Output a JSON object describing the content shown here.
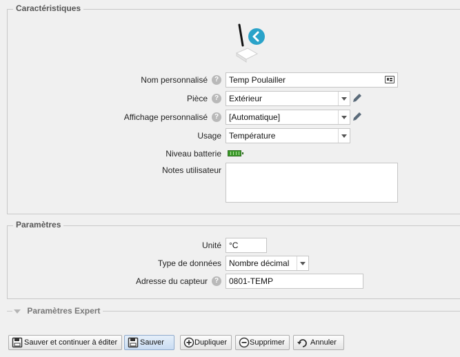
{
  "characteristics": {
    "legend": "Caractéristiques",
    "name": {
      "label": "Nom personnalisé",
      "value": "Temp Poulailler"
    },
    "room": {
      "label": "Pièce",
      "value": "Extérieur"
    },
    "display": {
      "label": "Affichage personnalisé",
      "value": "[Automatique]"
    },
    "usage": {
      "label": "Usage",
      "value": "Température"
    },
    "battery": {
      "label": "Niveau batterie",
      "level": 1.0
    },
    "notes": {
      "label": "Notes utilisateur",
      "value": ""
    }
  },
  "parameters": {
    "legend": "Paramètres",
    "unit": {
      "label": "Unité",
      "value": "°C"
    },
    "data_type": {
      "label": "Type de données",
      "value": "Nombre décimal"
    },
    "address": {
      "label": "Adresse du capteur",
      "value": "0801-TEMP"
    }
  },
  "expert": {
    "legend": "Paramètres Expert"
  },
  "buttons": {
    "save_continue": "Sauver et continuer à éditer",
    "save": "Sauver",
    "duplicate": "Dupliquer",
    "delete": "Supprimer",
    "cancel": "Annuler"
  },
  "colors": {
    "accent": "#2aa3c9",
    "battery": "#3c9a2a"
  }
}
